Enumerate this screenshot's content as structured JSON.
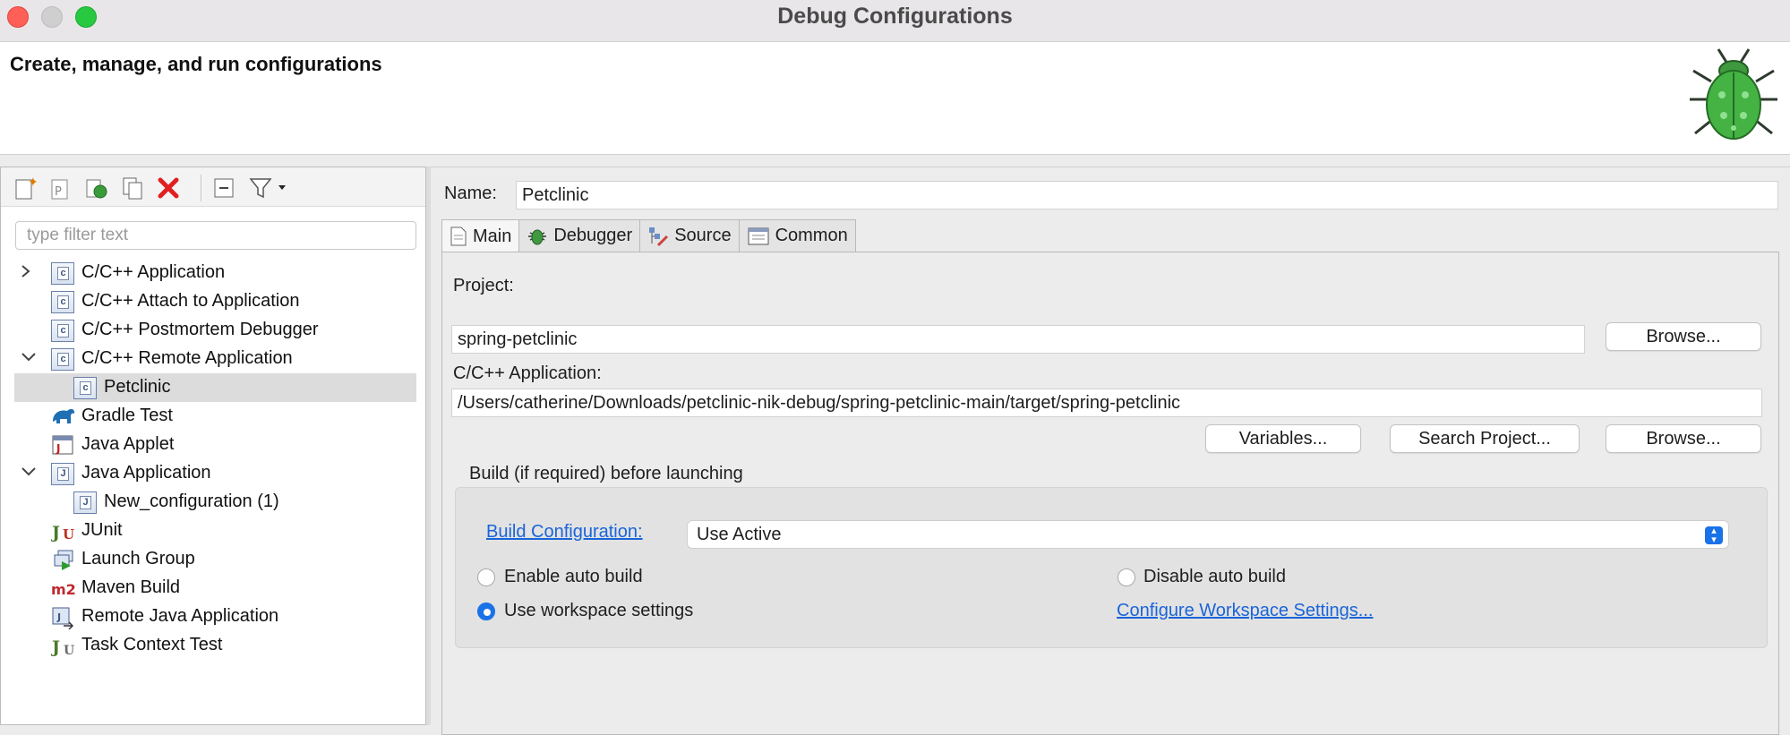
{
  "window": {
    "title": "Debug Configurations"
  },
  "banner": {
    "title": "Create, manage, and run configurations"
  },
  "left": {
    "filter_placeholder": "type filter text",
    "tree": [
      {
        "label": "C/C++ Application",
        "expander": "›",
        "icon": "c-config-icon"
      },
      {
        "label": "C/C++ Attach to Application",
        "expander": "",
        "icon": "c-config-icon"
      },
      {
        "label": "C/C++ Postmortem Debugger",
        "expander": "",
        "icon": "c-config-icon"
      },
      {
        "label": "C/C++ Remote Application",
        "expander": "⌄",
        "icon": "c-config-icon"
      },
      {
        "label": "Petclinic",
        "expander": "",
        "icon": "c-config-icon",
        "selected": true
      },
      {
        "label": "Gradle Test",
        "expander": "",
        "icon": "gradle-icon"
      },
      {
        "label": "Java Applet",
        "expander": "",
        "icon": "java-applet-icon"
      },
      {
        "label": "Java Application",
        "expander": "⌄",
        "icon": "java-app-icon"
      },
      {
        "label": "New_configuration (1)",
        "expander": "",
        "icon": "java-app-icon"
      },
      {
        "label": "JUnit",
        "expander": "",
        "icon": "junit-icon"
      },
      {
        "label": "Launch Group",
        "expander": "",
        "icon": "launch-group-icon"
      },
      {
        "label": "Maven Build",
        "expander": "",
        "icon": "maven-icon"
      },
      {
        "label": "Remote Java Application",
        "expander": "",
        "icon": "remote-java-icon"
      },
      {
        "label": "Task Context Test",
        "expander": "",
        "icon": "task-context-icon"
      }
    ]
  },
  "right": {
    "name_label": "Name:",
    "name_value": "Petclinic",
    "tabs": [
      {
        "label": "Main",
        "icon": "document-icon"
      },
      {
        "label": "Debugger",
        "icon": "bug-icon"
      },
      {
        "label": "Source",
        "icon": "source-icon"
      },
      {
        "label": "Common",
        "icon": "common-icon"
      }
    ],
    "main": {
      "project_label": "Project:",
      "project_value": "spring-petclinic",
      "browse_label": "Browse...",
      "app_label": "C/C++ Application:",
      "app_value": "/Users/catherine/Downloads/petclinic-nik-debug/spring-petclinic-main/target/spring-petclinic",
      "variables_label": "Variables...",
      "search_project_label": "Search Project...",
      "browse2_label": "Browse...",
      "build_group_label": "Build (if required) before launching",
      "build_config_link": "Build Configuration:",
      "build_config_value": "Use Active",
      "enable_auto_build": "Enable auto build",
      "disable_auto_build": "Disable auto build",
      "use_workspace_settings": "Use workspace settings",
      "configure_workspace_link": "Configure Workspace Settings..."
    }
  }
}
